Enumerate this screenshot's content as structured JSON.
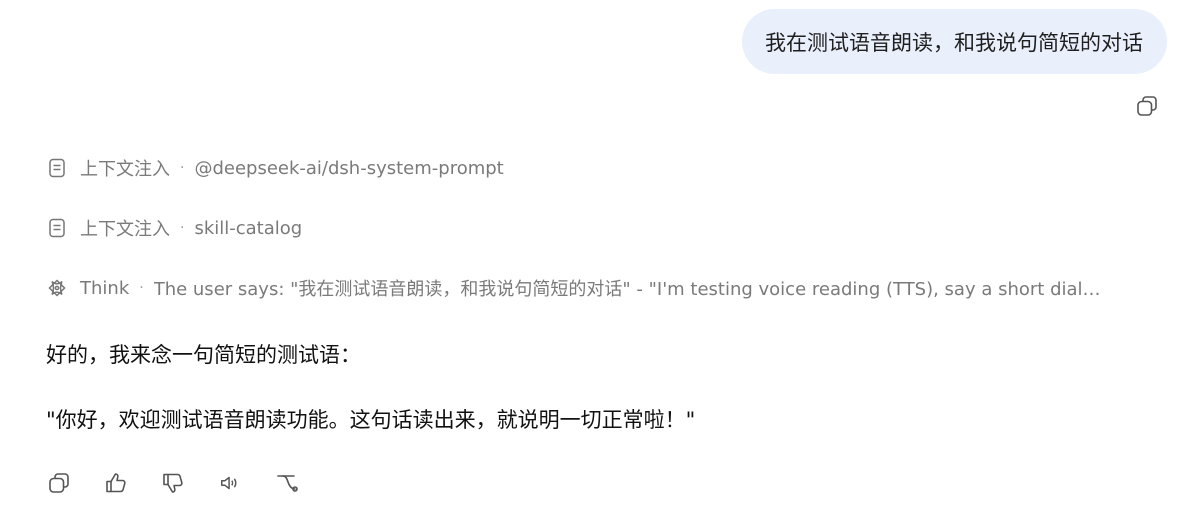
{
  "user_message": {
    "text": "我在测试语音朗读，和我说句简短的对话"
  },
  "steps": [
    {
      "icon": "document-icon",
      "label": "上下文注入",
      "detail": "@deepseek-ai/dsh-system-prompt"
    },
    {
      "icon": "document-icon",
      "label": "上下文注入",
      "detail": "skill-catalog"
    },
    {
      "icon": "think-icon",
      "label": "Think",
      "detail": "The user says: \"我在测试语音朗读，和我说句简短的对话\" - \"I'm testing voice reading (TTS), say a short dial…"
    }
  ],
  "separator": "·",
  "assistant": {
    "paragraphs": [
      "好的，我来念一句简短的测试语：",
      "\"你好，欢迎测试语音朗读功能。这句话读出来，就说明一切正常啦！\""
    ]
  },
  "actions": [
    "copy-icon",
    "thumbs-up-icon",
    "thumbs-down-icon",
    "speaker-icon",
    "branch-icon"
  ],
  "colors": {
    "bubble_bg": "#e9effb",
    "muted_text": "#7a7a7a",
    "icon": "#555555"
  }
}
